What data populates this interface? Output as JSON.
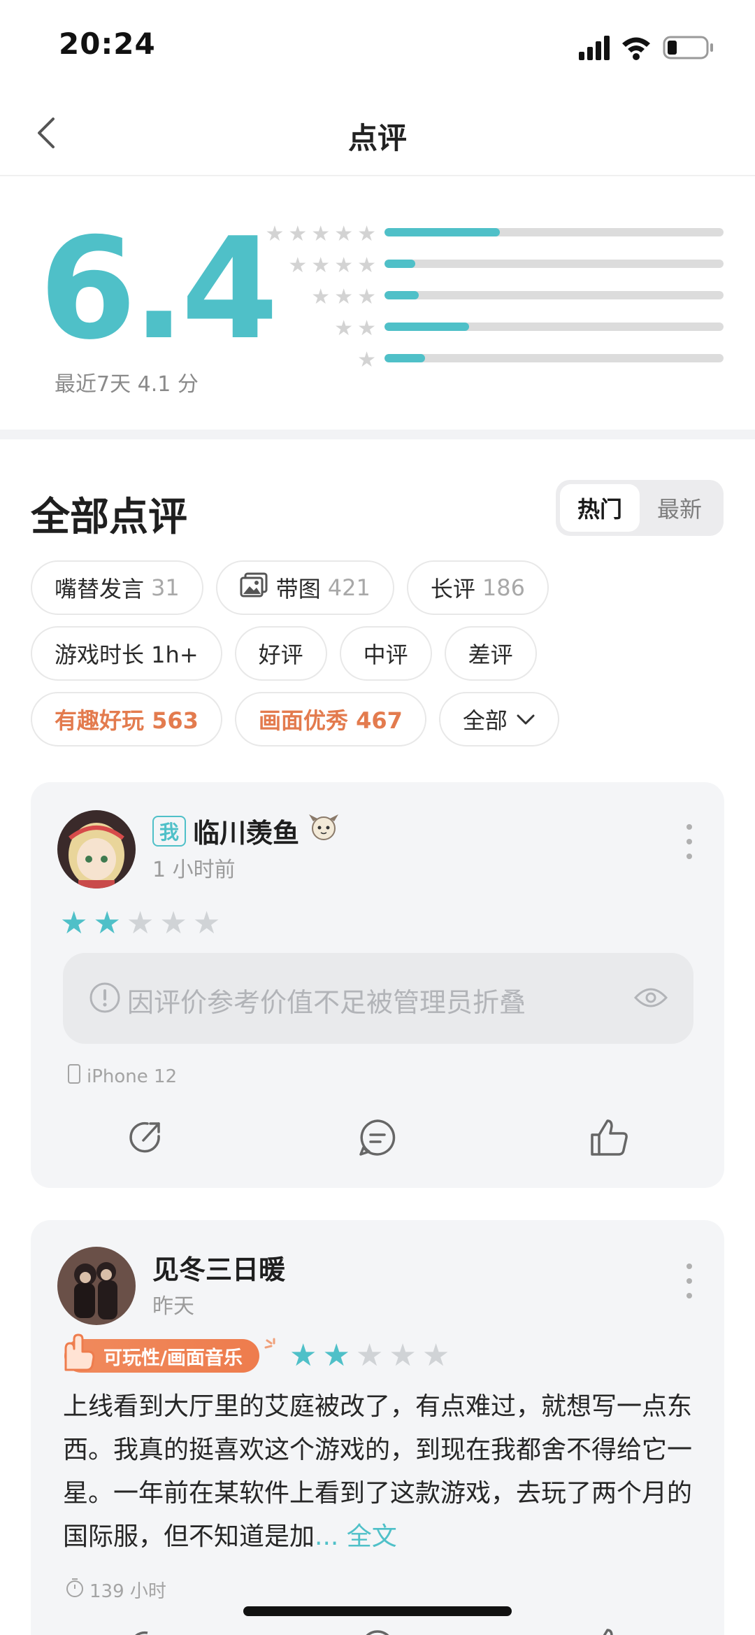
{
  "status_bar": {
    "time": "20:24"
  },
  "nav": {
    "title": "点评"
  },
  "rating": {
    "score": "6.4",
    "recent": "最近7天 4.1 分",
    "distribution": [
      {
        "stars": 5,
        "fraction": 0.34
      },
      {
        "stars": 4,
        "fraction": 0.09
      },
      {
        "stars": 3,
        "fraction": 0.1
      },
      {
        "stars": 2,
        "fraction": 0.25
      },
      {
        "stars": 1,
        "fraction": 0.12
      }
    ]
  },
  "reviews_section": {
    "title": "全部点评",
    "sort": {
      "hot": "热门",
      "new": "最新"
    }
  },
  "filters": {
    "row1": [
      {
        "label": "嘴替发言",
        "count": "31"
      },
      {
        "label": "带图",
        "count": "421"
      },
      {
        "label": "长评",
        "count": "186"
      }
    ],
    "row2": [
      {
        "label": "游戏时长 1h+"
      },
      {
        "label": "好评"
      },
      {
        "label": "中评"
      },
      {
        "label": "差评"
      }
    ],
    "row3": [
      {
        "label": "有趣好玩 563"
      },
      {
        "label": "画面优秀 467"
      },
      {
        "label": "全部"
      }
    ]
  },
  "review1": {
    "badge": "我",
    "username": "临川羡鱼",
    "time": "1 小时前",
    "rating": 2,
    "folded_notice": "因评价参考价值不足被管理员折叠",
    "device": "iPhone 12"
  },
  "review2": {
    "username": "见冬三日暖",
    "time": "昨天",
    "tag": "可玩性/画面音乐",
    "rating": 2,
    "text": "上线看到大厅里的艾庭被改了，有点难过，就想写一点东西。我真的挺喜欢这个游戏的，到现在我都舍不得给它一星。一年前在某软件上看到了这款游戏，去玩了两个月的国际服，但不知道是加",
    "more": "... 全文",
    "playtime": "139 小时"
  },
  "colors": {
    "accent": "#4fc0c8",
    "orange": "#ee7c4d"
  }
}
